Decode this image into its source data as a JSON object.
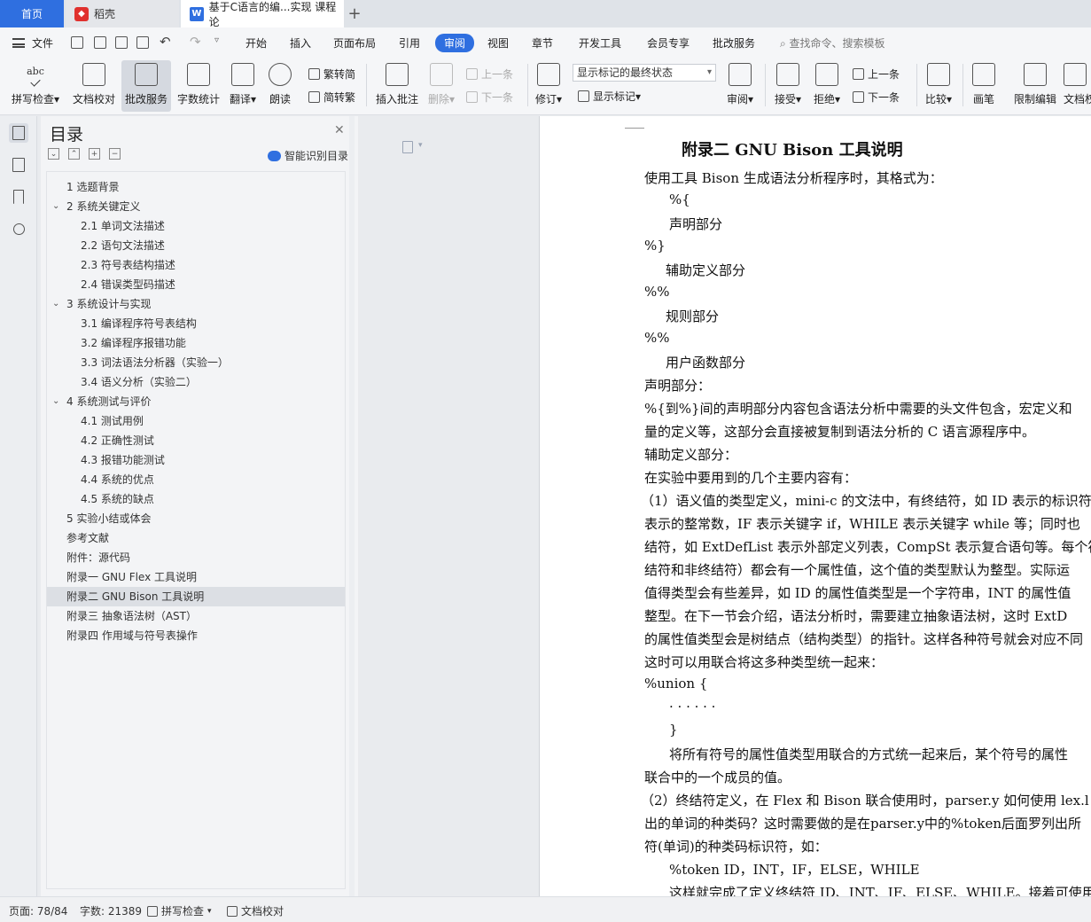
{
  "tabs": {
    "home": "首页",
    "daoke": "稻壳",
    "document": "基于C语言的编...实现 课程论",
    "new_tab": "+"
  },
  "menu": {
    "file": "文件",
    "items": [
      "开始",
      "插入",
      "页面布局",
      "引用",
      "审阅",
      "视图",
      "章节",
      "开发工具",
      "会员专享",
      "批改服务"
    ],
    "active": "审阅",
    "search_placeholder": "查找命令、搜索模板"
  },
  "ribbon": {
    "spellcheck": "拼写检查",
    "doc_proof": "文档校对",
    "correction_service": "批改服务",
    "word_count": "字数统计",
    "translate": "翻译",
    "read_aloud": "朗读",
    "to_traditional": "繁转简",
    "to_simplified": "简转繁",
    "insert_comment": "插入批注",
    "delete": "删除",
    "prev_comment": "上一条",
    "next_comment": "下一条",
    "revise": "修订",
    "markup_mode": "显示标记的最终状态",
    "show_markup": "显示标记",
    "review": "审阅",
    "accept": "接受",
    "reject": "拒绝",
    "prev_change": "上一条",
    "next_change": "下一条",
    "compare": "比较",
    "pen": "画笔",
    "restrict_edit": "限制编辑",
    "doc_permission": "文档权"
  },
  "toc": {
    "title": "目录",
    "smart_label": "智能识别目录",
    "items": [
      {
        "label": "1 选题背景",
        "level": 1
      },
      {
        "label": "2 系统关键定义",
        "level": 1,
        "expanded": true
      },
      {
        "label": "2.1 单词文法描述",
        "level": 2
      },
      {
        "label": "2.2 语句文法描述",
        "level": 2
      },
      {
        "label": "2.3  符号表结构描述",
        "level": 2
      },
      {
        "label": "2.4  错误类型码描述",
        "level": 2
      },
      {
        "label": "3 系统设计与实现",
        "level": 1,
        "expanded": true
      },
      {
        "label": "3.1 编译程序符号表结构",
        "level": 2
      },
      {
        "label": "3.2 编译程序报错功能",
        "level": 2
      },
      {
        "label": "3.3 词法语法分析器（实验一）",
        "level": 2
      },
      {
        "label": "3.4 语义分析（实验二）",
        "level": 2
      },
      {
        "label": "4 系统测试与评价",
        "level": 1,
        "expanded": true
      },
      {
        "label": "4.1  测试用例",
        "level": 2
      },
      {
        "label": "4.2  正确性测试",
        "level": 2
      },
      {
        "label": "4.3  报错功能测试",
        "level": 2
      },
      {
        "label": "4.4  系统的优点",
        "level": 2
      },
      {
        "label": "4.5  系统的缺点",
        "level": 2
      },
      {
        "label": "5 实验小结或体会",
        "level": 1
      },
      {
        "label": "参考文献",
        "level": 1
      },
      {
        "label": "附件：源代码",
        "level": 1
      },
      {
        "label": "附录一  GNU Flex  工具说明",
        "level": 1
      },
      {
        "label": "附录二  GNU Bison  工具说明",
        "level": 1,
        "selected": true
      },
      {
        "label": "附录三  抽象语法树（AST）",
        "level": 1
      },
      {
        "label": "附录四  作用域与符号表操作",
        "level": 1
      }
    ]
  },
  "document": {
    "title": "附录二  GNU Bison  工具说明",
    "lines": [
      {
        "text": "使用工具 Bison 生成语法分析程序时，其格式为：",
        "indent": 0
      },
      {
        "text": "%{",
        "indent": 28
      },
      {
        "text": "声明部分",
        "indent": 28
      },
      {
        "text": "%}",
        "indent": 0
      },
      {
        "text": "辅助定义部分",
        "indent": 24
      },
      {
        "text": "%%",
        "indent": 0
      },
      {
        "text": "规则部分",
        "indent": 24
      },
      {
        "text": "%%",
        "indent": 0
      },
      {
        "text": "用户函数部分",
        "indent": 24
      },
      {
        "text": "声明部分：",
        "indent": 0
      },
      {
        "text": "%{到%}间的声明部分内容包含语法分析中需要的头文件包含，宏定义和",
        "indent": 0
      },
      {
        "text": "量的定义等，这部分会直接被复制到语法分析的 C 语言源程序中。",
        "indent": 0
      },
      {
        "text": "辅助定义部分：",
        "indent": 0
      },
      {
        "text": "在实验中要用到的几个主要内容有：",
        "indent": 0
      },
      {
        "text": "（1）语义值的类型定义，mini-c 的文法中，有终结符，如 ID 表示的标识符",
        "indent": -4
      },
      {
        "text": "表示的整常数，IF 表示关键字 if，WHILE 表示关键字 while 等；同时也",
        "indent": 0
      },
      {
        "text": "结符，如 ExtDefList 表示外部定义列表，CompSt 表示复合语句等。每个符",
        "indent": 0
      },
      {
        "text": "结符和非终结符）都会有一个属性值，这个值的类型默认为整型。实际运",
        "indent": 0
      },
      {
        "text": "值得类型会有些差异，如 ID 的属性值类型是一个字符串，INT 的属性值",
        "indent": 0
      },
      {
        "text": "整型。在下一节会介绍，语法分析时，需要建立抽象语法树，这时 ExtD",
        "indent": 0
      },
      {
        "text": "的属性值类型会是树结点（结构类型）的指针。这样各种符号就会对应不同",
        "indent": 0
      },
      {
        "text": "这时可以用联合将这多种类型统一起来：",
        "indent": 0
      },
      {
        "text": "%union {",
        "indent": 0
      },
      {
        "text": "· · · · · ·",
        "indent": 28
      },
      {
        "text": "}",
        "indent": 28
      },
      {
        "text": "将所有符号的属性值类型用联合的方式统一起来后，某个符号的属性",
        "indent": 28
      },
      {
        "text": "联合中的一个成员的值。",
        "indent": 0
      },
      {
        "text": "（2）终结符定义，在 Flex 和 Bison 联合使用时，parser.y 如何使用 lex.l",
        "indent": -4
      },
      {
        "text": "出的单词的种类码？这时需要做的是在parser.y中的%token后面罗列出所",
        "indent": 0
      },
      {
        "text": "符(单词)的种类码标识符，如：",
        "indent": 0
      },
      {
        "text": "%token     ID，INT，IF，ELSE，WHILE",
        "indent": 28
      },
      {
        "text": "这样就完成了定义终结符 ID、INT、IF、ELSE、WHILE。接着可使用",
        "indent": 28
      }
    ]
  },
  "status": {
    "page": "页面: 78/84",
    "words": "字数: 21389",
    "spellcheck": "拼写检查",
    "doc_proof": "文档校对"
  }
}
